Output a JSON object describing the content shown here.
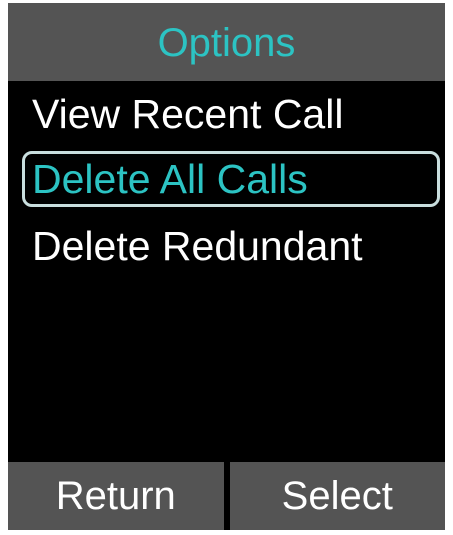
{
  "header": {
    "title": "Options"
  },
  "menu": {
    "items": [
      {
        "label": "View Recent Call",
        "selected": false
      },
      {
        "label": "Delete All Calls",
        "selected": true
      },
      {
        "label": "Delete Redundant",
        "selected": false
      }
    ]
  },
  "softkeys": {
    "left_label": "Return",
    "right_label": "Select"
  },
  "colors": {
    "accent": "#2cc3c3",
    "bar_background": "#545454",
    "screen_background": "#000000",
    "text": "#ffffff",
    "selection_border": "#c9dede"
  }
}
